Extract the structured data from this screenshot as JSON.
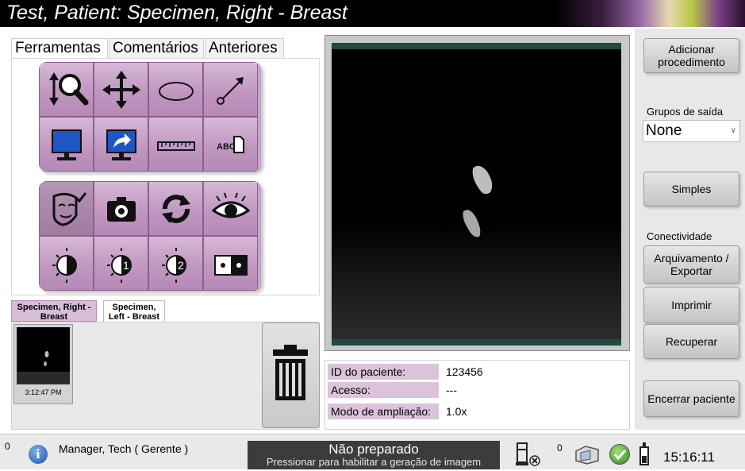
{
  "window": {
    "title": "Test, Patient:  Specimen, Right - Breast"
  },
  "tabs": [
    {
      "label": "Ferramentas",
      "active": true
    },
    {
      "label": "Comentários",
      "active": false
    },
    {
      "label": "Anteriores",
      "active": false
    }
  ],
  "tools": {
    "row1": [
      "zoom-icon",
      "pan-icon",
      "ellipse-icon",
      "arrow-icon"
    ],
    "row2": [
      "monitor-icon",
      "send-icon",
      "ruler-icon",
      "text-label-icon"
    ],
    "row3": [
      "face-check-icon",
      "camera-icon",
      "refresh-icon",
      "eye-icon"
    ],
    "row4": [
      "contrast-icon",
      "contrast-1-icon",
      "contrast-2-icon",
      "split-view-icon"
    ],
    "text_label": "ABC",
    "contrast_1": "1",
    "contrast_2": "2"
  },
  "thumbnail_tabs": [
    {
      "label": "Specimen, Right - Breast",
      "active": true
    },
    {
      "label": "Specimen, Left - Breast",
      "active": false
    }
  ],
  "thumbnail": {
    "time": "3:12:47 PM"
  },
  "patient_info": {
    "rows": [
      {
        "label": "ID do paciente:",
        "value": "123456"
      },
      {
        "label": "Acesso:",
        "value": "---"
      },
      {
        "label": "Modo de ampliação:",
        "value": "1.0x"
      }
    ]
  },
  "right_panel": {
    "add_procedure": "Adicionar procedimento",
    "output_groups_label": "Grupos de saída",
    "output_group_value": "None",
    "simple_button": "Simples",
    "connectivity_label": "Conectividade",
    "archive_export": "Arquivamento / Exportar",
    "print": "Imprimir",
    "recover": "Recuperar",
    "close_patient": "Encerrar paciente"
  },
  "status_bar": {
    "alert_count": "0",
    "user": "Manager, Tech ( Gerente )",
    "status_title": "Não preparado",
    "status_subtitle": "Pressionar para habilitar a geração de imagem",
    "queue_count": "0",
    "clock": "15:16:11"
  },
  "colors": {
    "tool_button": "#c8a3c8",
    "info_label_bg": "#dbc3db",
    "status_bg": "#3c3c3c",
    "viewer_frame_accent": "#1f4a45"
  }
}
